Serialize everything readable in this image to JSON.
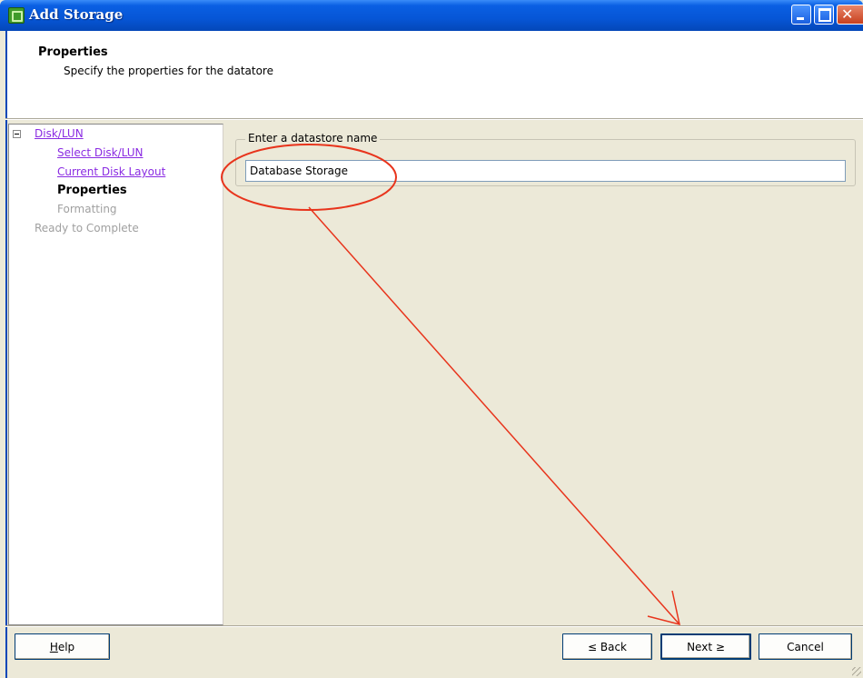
{
  "window": {
    "title": "Add Storage",
    "icon": "datastore-icon"
  },
  "header": {
    "title": "Properties",
    "subtitle": "Specify the properties for the datatore"
  },
  "nav": {
    "root": "Disk/LUN",
    "items": [
      {
        "label": "Select Disk/LUN",
        "state": "visited"
      },
      {
        "label": "Current Disk Layout",
        "state": "visited"
      },
      {
        "label": "Properties",
        "state": "current"
      },
      {
        "label": "Formatting",
        "state": "disabled"
      }
    ],
    "final": "Ready to Complete"
  },
  "form": {
    "group_label": "Enter a datastore name",
    "datastore_name": "Database Storage"
  },
  "buttons": {
    "help": "Help",
    "back": "≤ Back",
    "next": "Next ≥",
    "cancel": "Cancel"
  },
  "annotation_color": "#e8341c"
}
